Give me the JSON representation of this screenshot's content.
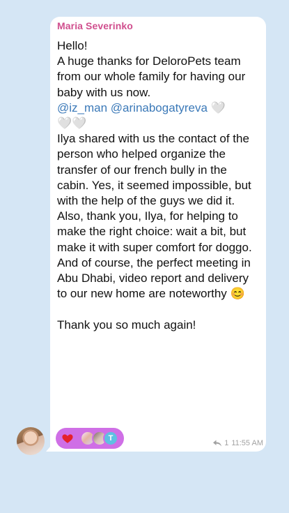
{
  "message": {
    "sender_name": "Maria Severinko",
    "greeting": "Hello!",
    "text_before_mentions": "A huge thanks for DeloroPets team from our whole family for having our baby with us now.",
    "mention_1": "@iz_man",
    "mention_2": "@arinabogatyreva",
    "hearts_line_1": "🤍",
    "hearts_line_2": "🤍🤍",
    "paragraph_1": "Ilya shared with us the contact of the person who helped organize the transfer of our french bully in the cabin. Yes, it seemed impossible, but with the help of the guys we did it.",
    "paragraph_2": "Also, thank you, Ilya, for helping to make the right choice: wait a bit, but make it with super comfort for doggo.",
    "paragraph_3": "And of course, the perfect meeting in Abu Dhabi, video report and delivery to our new home are noteworthy 😊",
    "closing": "Thank you so much again!",
    "reply_count": "1",
    "time": "11:55 AM"
  },
  "reactions": {
    "emoji": "heart",
    "reactor_initial": "T"
  },
  "colors": {
    "background": "#d5e6f5",
    "sender_name": "#d04f8e",
    "mention": "#3b79b8",
    "reaction_pill": "#cf6fe6",
    "reaction_heart": "#e5212b"
  },
  "icons": {
    "reply": "reply-arrow-icon",
    "reaction": "heart-icon"
  }
}
